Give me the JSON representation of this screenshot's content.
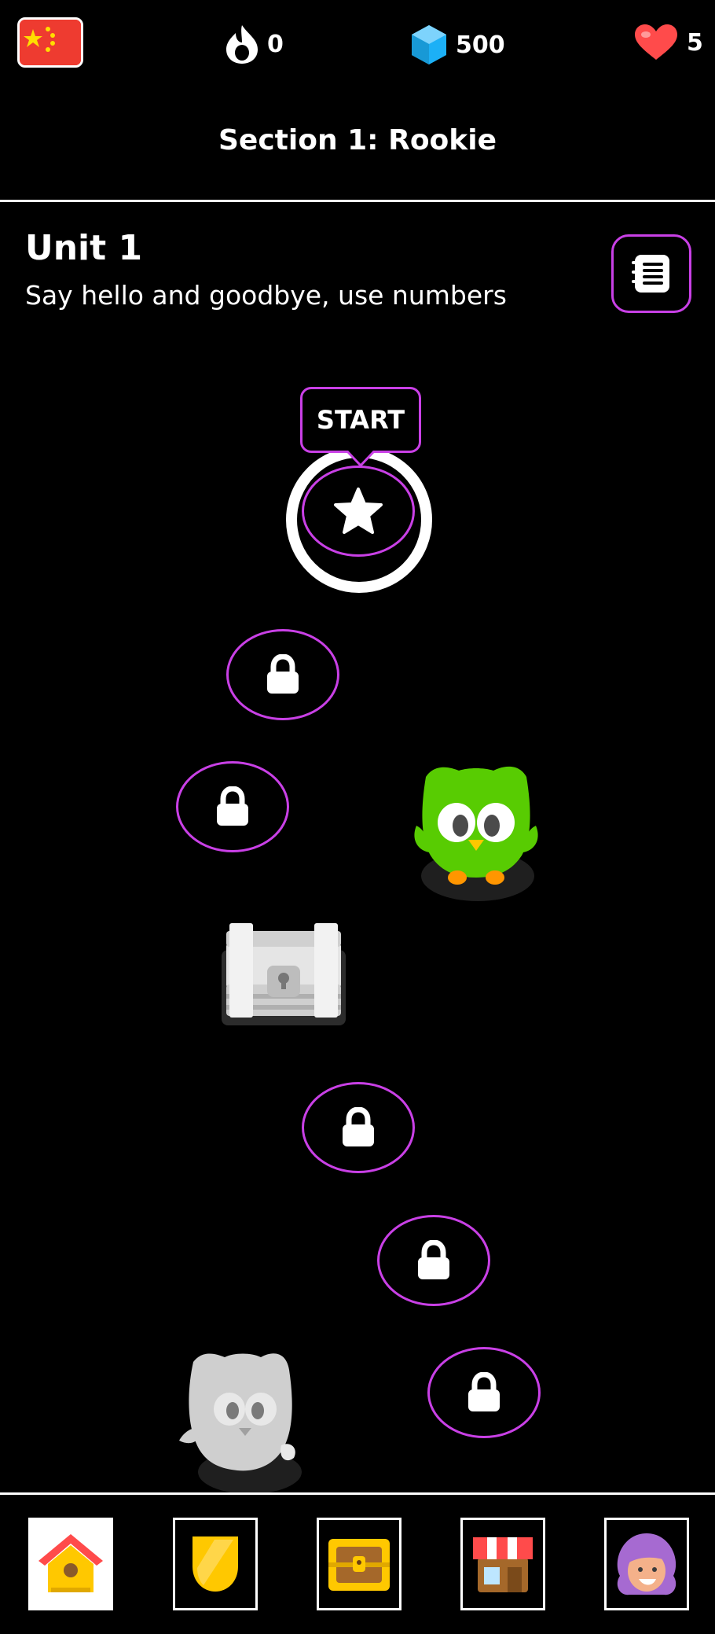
{
  "header": {
    "flag_icon": "china-flag-icon",
    "streak": {
      "icon": "flame-icon",
      "value": "0"
    },
    "gems": {
      "icon": "gem-icon",
      "value": "500"
    },
    "hearts": {
      "icon": "heart-icon",
      "value": "5"
    },
    "section_title": "Section 1: Rookie"
  },
  "unit": {
    "title": "Unit 1",
    "subtitle": "Say hello and goodbye, use numbers",
    "guide_icon": "guidebook-icon"
  },
  "path": {
    "start_label": "START",
    "current_node_icon": "star-icon",
    "locked_icon": "lock-icon",
    "chest_icon": "treasure-chest-icon",
    "mascot_icon": "owl-mascot-icon",
    "mascot_gray_icon": "owl-mascot-gray-icon"
  },
  "tabs": [
    {
      "name": "home",
      "icon": "home-icon"
    },
    {
      "name": "leagues",
      "icon": "shield-icon"
    },
    {
      "name": "quests",
      "icon": "chest-icon"
    },
    {
      "name": "shop",
      "icon": "shop-icon"
    },
    {
      "name": "profile",
      "icon": "avatar-icon"
    }
  ],
  "colors": {
    "accent": "#c940e6",
    "background": "#000000",
    "gem": "#1cb0f6",
    "heart": "#ff4b4b",
    "owl": "#58cc02"
  }
}
